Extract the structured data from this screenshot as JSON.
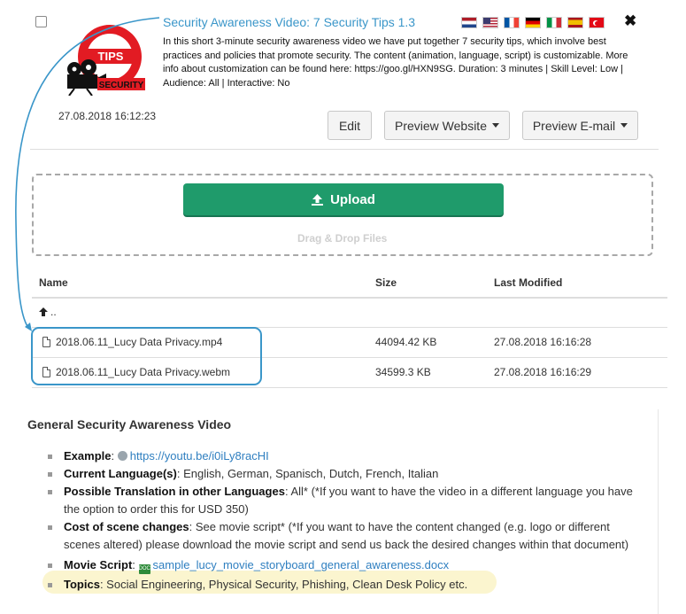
{
  "header": {
    "title": "Security Awareness Video: 7 Security Tips 1.3",
    "description": "In this short 3-minute security awareness video we have put together 7 security tips, which involve best practices and policies that promote security. The content (animation, language, script) is customizable. More info about customization can be found here: https://goo.gl/HXN9SG. Duration: 3 minutes | Skill Level: Low | Audience: All | Interactive: No",
    "timestamp": "27.08.2018 16:12:23",
    "logo_text_top": "TIPS",
    "logo_text_bottom": "SECURITY",
    "flags": [
      "netherlands-flag",
      "usa-flag",
      "france-flag",
      "germany-flag",
      "italy-flag",
      "spain-flag",
      "turkey-flag"
    ],
    "close_label": "✖"
  },
  "buttons": {
    "edit": "Edit",
    "preview_website": "Preview Website",
    "preview_email": "Preview E-mail"
  },
  "upload": {
    "label": "Upload",
    "drag_text": "Drag & Drop Files"
  },
  "files": {
    "columns": [
      "Name",
      "Size",
      "Last Modified"
    ],
    "parent": "..",
    "rows": [
      {
        "name": "2018.06.11_Lucy Data Privacy.mp4",
        "size": "44094.42 KB",
        "modified": "27.08.2018 16:16:28"
      },
      {
        "name": "2018.06.11_Lucy Data Privacy.webm",
        "size": "34599.3 KB",
        "modified": "27.08.2018 16:16:29"
      }
    ]
  },
  "info": {
    "title": "General Security Awareness Video",
    "example_label": "Example",
    "example_link": "https://youtu.be/i0iLy8racHI",
    "languages_label": "Current Language(s)",
    "languages_value": "English, German, Spanisch, Dutch, French, Italian",
    "translation_label": "Possible Translation in other Languages",
    "translation_value": "All* (*If you want to have the video in a different language you have the option to order this for USD 350)",
    "scene_label": "Cost of scene changes",
    "scene_value": "See movie script* (*If you want to have the content changed (e.g. logo or different scenes altered) please download the movie script and send us back the desired changes within that document)",
    "script_label": "Movie Script",
    "script_link": "sample_lucy_movie_storyboard_general_awareness.docx",
    "topics_label": "Topics",
    "topics_value": "Social Engineering, Physical Security, Phishing, Clean Desk Policy etc."
  },
  "colors": {
    "accent": "#3a96c9",
    "upload_green": "#1f9b6b",
    "logo_red": "#e21b23",
    "highlight_yellow": "#fbf5cf"
  }
}
